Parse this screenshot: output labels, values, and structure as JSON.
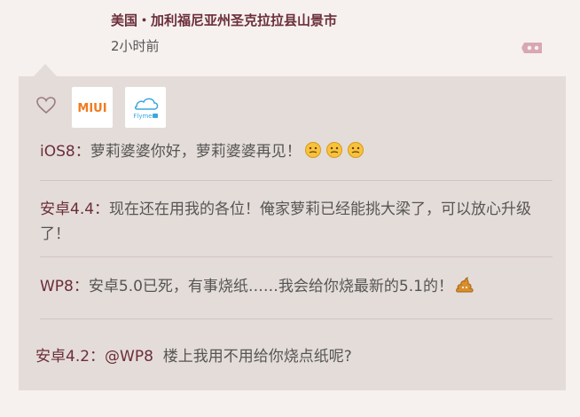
{
  "header": {
    "location": "美国・加利福尼亚州圣克拉拉县山景市",
    "time": "2小时前"
  },
  "badges": {
    "miui": "MIUI",
    "flyme": "Flyme"
  },
  "comments": [
    {
      "author": "iOS8：",
      "text": "萝莉婆婆你好，萝莉婆婆再见！",
      "emoji": [
        "thinking-emoji",
        "thinking-emoji",
        "thinking-emoji"
      ]
    },
    {
      "author": "安卓4.4：",
      "text": "现在还在用我的各位！俺家萝莉已经能挑大梁了，可以放心升级了！"
    },
    {
      "author": "WP8：",
      "text": "安卓5.0已死，有事烧纸……我会给你烧最新的5.1的！",
      "emoji": [
        "poop-emoji"
      ]
    },
    {
      "author": "安卓4.2：",
      "reply_to": "@WP8",
      "text": "楼上我用不用给你烧点纸呢?"
    }
  ],
  "colors": {
    "accent": "#6b2e39",
    "panel": "#e4dcd8",
    "badge_pink": "#d9a7b3"
  }
}
